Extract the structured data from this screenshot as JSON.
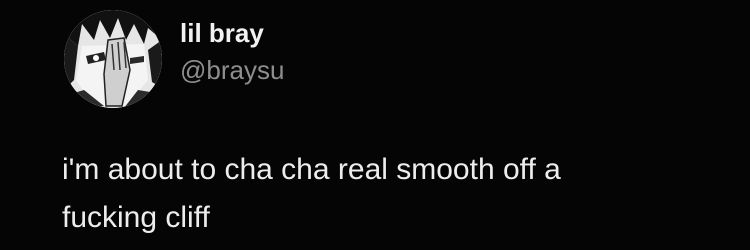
{
  "tweet": {
    "display_name": "lil bray",
    "handle": "@braysu",
    "text_lines": [
      "i'm about to cha cha real smooth off a",
      "fucking cliff"
    ],
    "avatar_icon": "anime-character-avatar"
  },
  "colors": {
    "background": "#000000",
    "name": "#f2f2f2",
    "handle": "#8e8e8e",
    "body_text": "#ededed"
  }
}
